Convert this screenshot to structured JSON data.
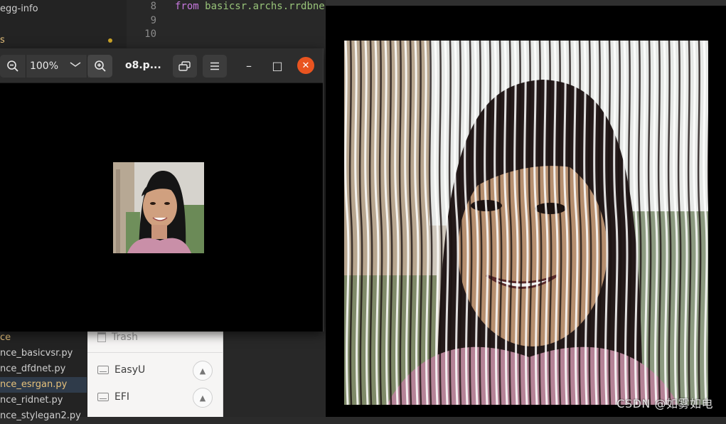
{
  "editor": {
    "tree_items": [
      {
        "label": "egg-info",
        "style": "normal"
      },
      {
        "label": "s",
        "style": "yellow"
      },
      {
        "label": "ce",
        "style": "yellow"
      },
      {
        "label": "nce_basicvsr.py",
        "style": "normal"
      },
      {
        "label": "nce_dfdnet.py",
        "style": "normal"
      },
      {
        "label": "nce_esrgan.py",
        "style": "selected"
      },
      {
        "label": "nce_ridnet.py",
        "style": "normal"
      },
      {
        "label": "nce_stylegan2.py",
        "style": "normal"
      }
    ],
    "line_numbers": [
      "8",
      "9",
      "10"
    ],
    "code_line": {
      "keyword": "from",
      "module": "basicsr.archs.rrdbne"
    }
  },
  "files_panel": {
    "trash_label": "Trash",
    "drives": [
      {
        "label": "EasyU",
        "icon": "drive-icon"
      },
      {
        "label": "EFI",
        "icon": "drive-icon"
      }
    ],
    "eject_icon": "▲"
  },
  "viewer": {
    "zoom_out_icon": "zoom-out-icon",
    "zoom_level": "100%",
    "zoom_in_icon": "zoom-in-icon",
    "title": "o8.p...",
    "minimize_icon": "–",
    "maximize_icon": "□",
    "close_icon": "✕",
    "accent_color": "#e95420"
  },
  "output": {
    "watermark": "CSDN @如雾如电"
  }
}
